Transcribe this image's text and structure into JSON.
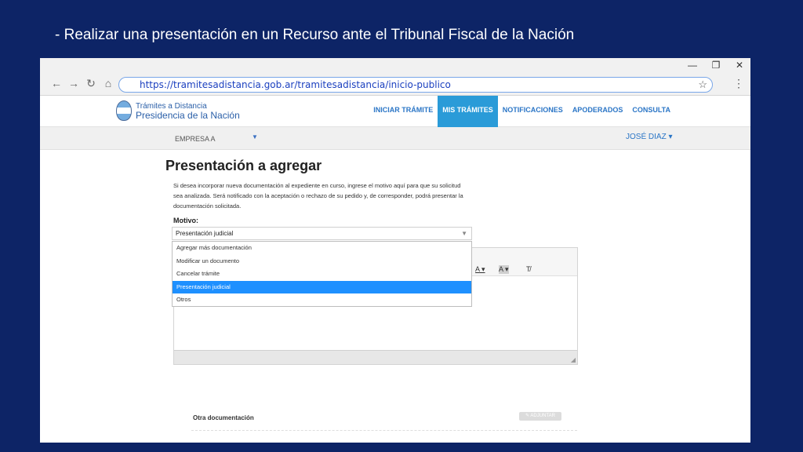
{
  "slide": {
    "title": "- Realizar una presentación en un Recurso ante el Tribunal Fiscal de la Nación"
  },
  "window_controls": {
    "minimize": "—",
    "restore": "❐",
    "close": "✕"
  },
  "browser": {
    "back": "←",
    "forward": "→",
    "reload": "↻",
    "home": "⌂",
    "url": "https://tramitesadistancia.gob.ar/tramitesadistancia/inicio-publico",
    "bookmark": "☆",
    "menu": "⋮"
  },
  "site": {
    "logo_line1": "Trámites a Distancia",
    "logo_line2": "Presidencia de la Nación",
    "nav": [
      "INICIAR TRÁMITE",
      "MIS TRÁMITES",
      "NOTIFICACIONES",
      "APODERADOS",
      "CONSULTA"
    ],
    "nav_active_color": "#2a9bd8",
    "company": "EMPRESA A",
    "company_arrow": "▼",
    "user": "JOSÉ DIAZ ▾"
  },
  "form": {
    "title": "Presentación a agregar",
    "description": "Si desea incorporar nueva documentación al expediente en curso, ingrese el motivo aquí para que su solicitud sea analizada. Será notificado con la aceptación o rechazo de su pedido y, de corresponder, podrá presentar la documentación solicitada.",
    "motivo_label": "Motivo:",
    "selected": "Presentación judicial",
    "select_arrow": "▼",
    "options": [
      "Agregar más documentación",
      "Modificar un documento",
      "Cancelar trámite",
      "Presentación judicial",
      "Otros"
    ],
    "highlight_color": "#1e90ff"
  },
  "editor_toolbar": {
    "font_color": "A ▾",
    "bg_color": "A ▾",
    "clear_format": "T̸"
  },
  "resize_grip": "◢",
  "other_docs": {
    "label": "Otra documentación",
    "attach": "✎ ADJUNTAR"
  }
}
